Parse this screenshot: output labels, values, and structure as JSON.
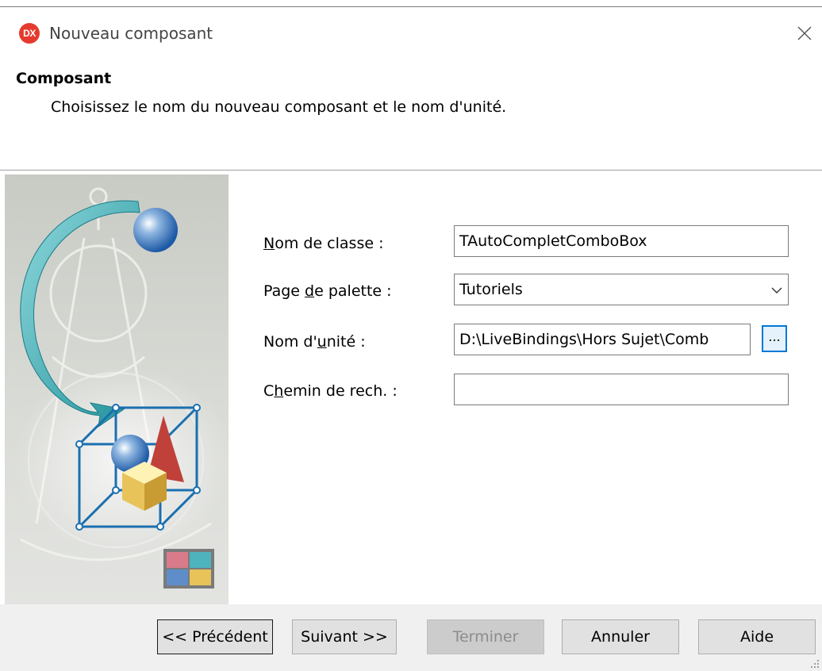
{
  "window": {
    "app_icon_text": "DX",
    "title": "Nouveau composant"
  },
  "header": {
    "title": "Composant",
    "description": "Choisissez le nom du nouveau composant et le nom d'unité."
  },
  "form": {
    "class_name": {
      "label_pre": "",
      "label_key": "N",
      "label_post": "om de classe :",
      "value": "TAutoCompletComboBox"
    },
    "palette_page": {
      "label_pre": "Page ",
      "label_key": "d",
      "label_post": "e palette :",
      "value": "Tutoriels"
    },
    "unit_name": {
      "label_pre": "Nom d'",
      "label_key": "u",
      "label_post": "nité :",
      "value": "D:\\LiveBindings\\Hors Sujet\\Comb",
      "browse_label": "..."
    },
    "search_path": {
      "label_pre": "C",
      "label_key": "h",
      "label_post": "emin de rech. :",
      "value": ""
    }
  },
  "buttons": {
    "previous": "<< Précédent",
    "next": "Suivant >>",
    "finish": "Terminer",
    "cancel": "Annuler",
    "help": "Aide"
  },
  "colors": {
    "accent": "#0078d7",
    "app_icon": "#e53b2e"
  }
}
